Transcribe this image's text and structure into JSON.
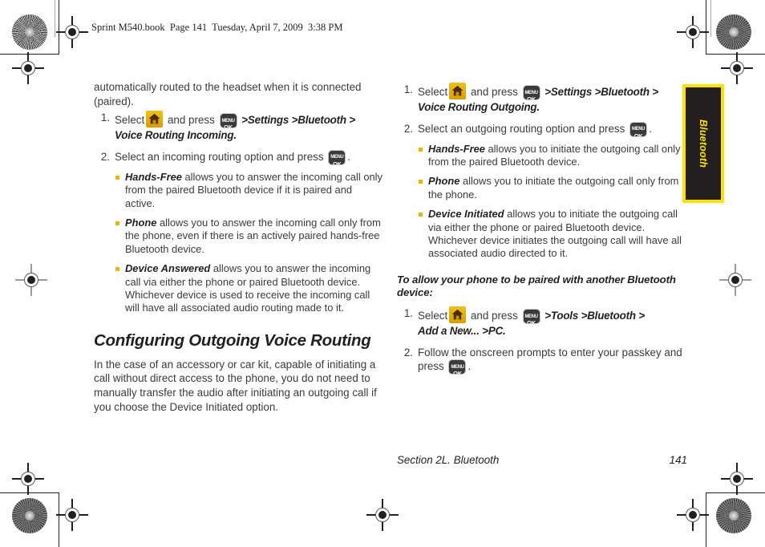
{
  "header": {
    "book_line": "Sprint M540.book  Page 141  Tuesday, April 7, 2009  3:38 PM"
  },
  "side_tab": {
    "label": "Bluetooth"
  },
  "colors": {
    "accent_gold": "#f0b400",
    "tab_yellow": "#ffe000",
    "tab_black": "#231f20",
    "body_text": "#3b3b3b"
  },
  "icons": {
    "home_key": "home-key-icon",
    "menu_ok_key": "menu-ok-key-icon",
    "menu_ok_line1": "MENU",
    "menu_ok_line2": "OK"
  },
  "left_column": {
    "intro_paragraph": "automatically routed to the headset when it is connected (paired).",
    "steps": [
      {
        "num": "1.",
        "lead": "Select",
        "mid": "and press",
        "nav_path": ">Settings >Bluetooth >",
        "nav_path_2": "Voice Routing Incoming."
      },
      {
        "num": "2.",
        "text": "Select an incoming routing option and press",
        "tail": ".",
        "bullets": [
          {
            "term": "Hands-Free",
            "text": " allows you to answer the incoming call only from the paired Bluetooth device if it is paired and active."
          },
          {
            "term": "Phone",
            "text": " allows you to answer the incoming call only from the phone, even if there is an actively paired hands-free Bluetooth device."
          },
          {
            "term": "Device Answered",
            "text": " allows you to answer the incoming call via either the phone or paired Bluetooth device. Whichever device is used to receive the incoming call will have all associated audio routing made to it."
          }
        ]
      }
    ],
    "section_heading": "Configuring Outgoing Voice Routing",
    "section_paragraph": "In the case of an accessory or car kit, capable of initiating a call without direct access to the phone, you do not need to manually transfer the audio after initiating an outgoing call if you choose the Device Initiated option."
  },
  "right_column": {
    "steps": [
      {
        "num": "1.",
        "lead": "Select",
        "mid": "and press",
        "nav_path": ">Settings >Bluetooth >",
        "nav_path_2": "Voice Routing Outgoing."
      },
      {
        "num": "2.",
        "text": "Select an outgoing routing option and press",
        "tail": ".",
        "bullets": [
          {
            "term": "Hands-Free",
            "text": " allows you to initiate the outgoing call only from the paired Bluetooth device."
          },
          {
            "term": "Phone",
            "text": " allows you to initiate the outgoing call only from the phone."
          },
          {
            "term": "Device Initiated",
            "text": " allows you to initiate the outgoing call via either the phone or paired Bluetooth device. Whichever device initiates the outgoing call will have all associated audio directed to it."
          }
        ]
      }
    ],
    "pairing_note": "To allow your phone to be paired with another Bluetooth device:",
    "pairing_steps": [
      {
        "num": "1.",
        "lead": "Select",
        "mid": "and press",
        "nav_path": ">Tools >Bluetooth >",
        "nav_path_2": "Add a New... >PC."
      },
      {
        "num": "2.",
        "text": "Follow the onscreen prompts to enter your passkey and press",
        "tail": "."
      }
    ]
  },
  "footer": {
    "section": "Section 2L. Bluetooth",
    "page_number": "141"
  }
}
